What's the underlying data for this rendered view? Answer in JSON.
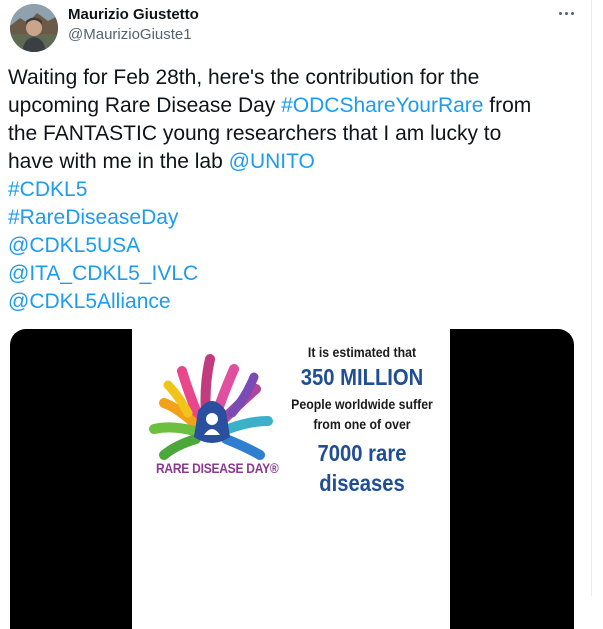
{
  "author": {
    "name": "Maurizio Giustetto",
    "handle": "@MaurizioGiuste1"
  },
  "tweet": {
    "line1": "Waiting for Feb 28th, here's the contribution for the",
    "line2_pre": "upcoming Rare Disease Day ",
    "line2_link": "#ODCShareYourRare",
    "line2_post": " from",
    "line3": "the FANTASTIC young researchers that I am lucky to",
    "line4_pre": "have with me in the lab ",
    "line4_link": "@UNITO",
    "tags": [
      "#CDKL5",
      "#RareDiseaseDay",
      "@CDKL5USA",
      "@ITA_CDKL5_IVLC",
      "@CDKL5Alliance"
    ]
  },
  "media": {
    "logo_text": "RARE DISEASE DAY®",
    "fact_line1": "It is estimated that",
    "fact_big1": "350 MILLION",
    "fact_line2": "People worldwide suffer",
    "fact_line3": "from one of over",
    "fact_big2": "7000 rare",
    "fact_big3": "diseases"
  },
  "icons": {
    "more": "more-horizontal-icon",
    "logo": "rare-disease-day-hands-logo"
  },
  "colors": {
    "link": "#1d9bf0",
    "fact_blue": "#1f4e93",
    "logo_purple": "#8a3a8f"
  }
}
